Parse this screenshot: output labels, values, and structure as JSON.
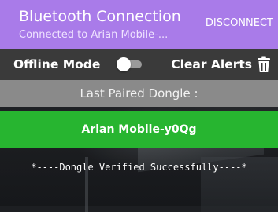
{
  "header": {
    "title": "Bluetooth Connection",
    "subtitle": "Connected to Arian Mobile-...",
    "disconnect_label": "DISCONNECT"
  },
  "controls": {
    "offline_label": "Offline Mode",
    "offline_enabled": false,
    "clear_alerts_label": "Clear Alerts",
    "trash_icon": "trash-icon"
  },
  "pairing": {
    "last_paired_label": "Last Paired Dongle :",
    "dongle_name": "Arian Mobile-y0Qg",
    "status_message": "*----Dongle Verified Successfully----*"
  },
  "colors": {
    "header": "#a97be9",
    "controls_bar": "#3a3a3a",
    "last_paired_bar": "#8a8a8a",
    "dongle_bar": "#27b530"
  }
}
